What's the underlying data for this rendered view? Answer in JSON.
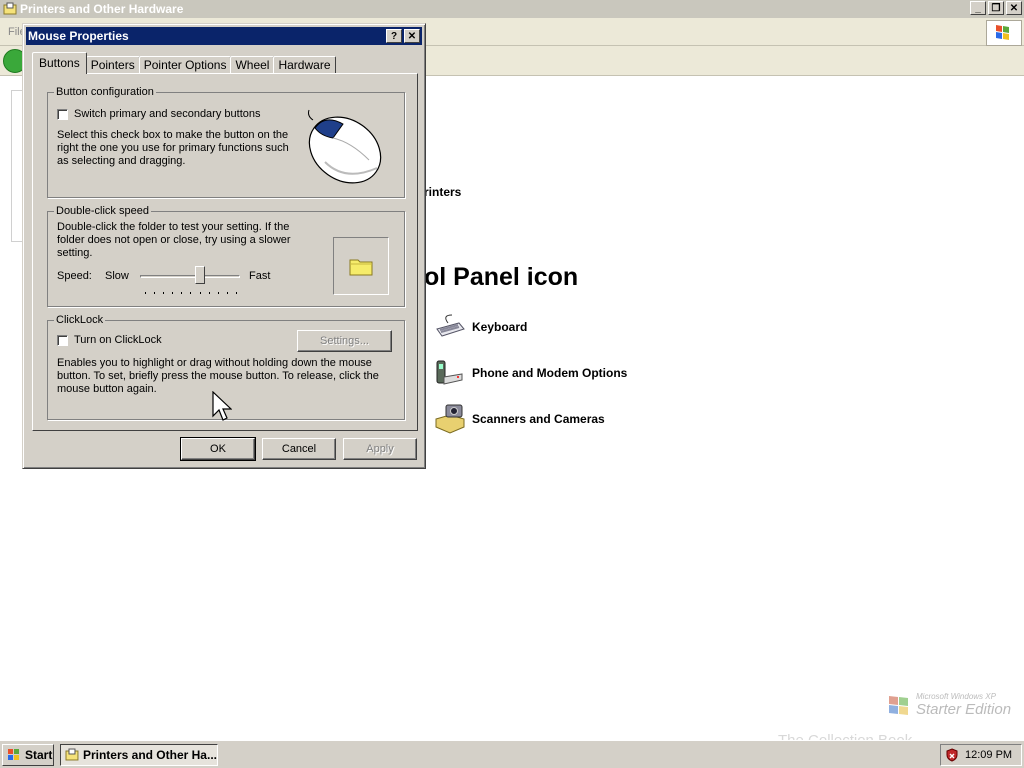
{
  "explorer": {
    "title": "Printers and Other Hardware",
    "menu_first": "File",
    "printers_label": "rinters",
    "heading": "ol Panel icon",
    "items": [
      {
        "label": "Keyboard",
        "icon": "keyboard-icon"
      },
      {
        "label": "Phone and Modem Options",
        "icon": "phone-modem-icon"
      },
      {
        "label": "Scanners and Cameras",
        "icon": "scanner-camera-icon"
      }
    ],
    "edition_small": "Microsoft Windows XP",
    "edition_big": "Starter Edition",
    "watermark": "The Collection Book"
  },
  "dialog": {
    "title": "Mouse Properties",
    "help_btn": "?",
    "close_btn": "X",
    "tabs": [
      "Buttons",
      "Pointers",
      "Pointer Options",
      "Wheel",
      "Hardware"
    ],
    "active_tab": "Buttons",
    "button_config": {
      "legend": "Button configuration",
      "checkbox_label": "Switch primary and secondary buttons",
      "checked": false,
      "description": "Select this check box to make the button on the right the one you use for primary functions such as selecting and dragging."
    },
    "double_click": {
      "legend": "Double-click speed",
      "description": "Double-click the folder to test your setting. If the folder does not open or close, try using a slower setting.",
      "speed_label": "Speed:",
      "slow_label": "Slow",
      "fast_label": "Fast",
      "speed_value": 0.6
    },
    "clicklock": {
      "legend": "ClickLock",
      "checkbox_label": "Turn on ClickLock",
      "checked": false,
      "settings_btn": "Settings...",
      "description": "Enables you to highlight or drag without holding down the mouse button. To set, briefly press the mouse button. To release, click the mouse button again."
    },
    "ok_btn": "OK",
    "cancel_btn": "Cancel",
    "apply_btn": "Apply"
  },
  "taskbar": {
    "start_label": "Start",
    "task_label": "Printers and Other Ha...",
    "clock": "12:09 PM"
  },
  "colors": {
    "dialog_title_bg": "#0a246a",
    "face": "#d4d0c8",
    "inactive_title": "#c9c7bd"
  }
}
